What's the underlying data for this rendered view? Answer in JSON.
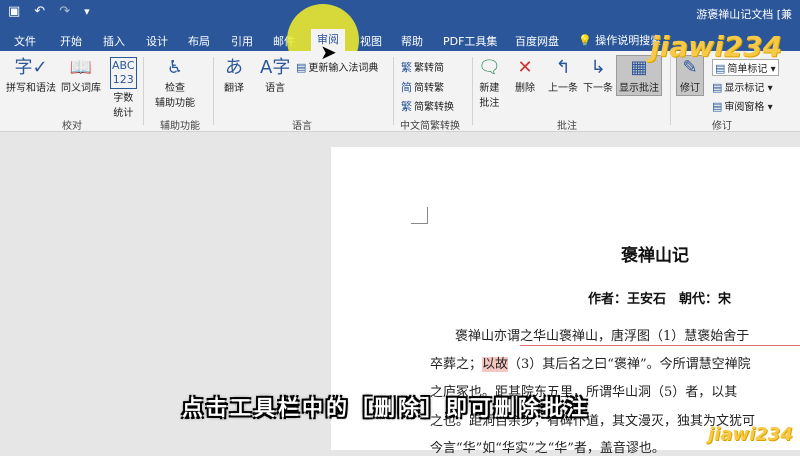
{
  "titlebar": {
    "doc_title": "游褒禅山记文档 [兼",
    "save_icon": "save-icon",
    "undo_icon": "undo-icon",
    "redo_icon": "redo-icon",
    "customize_icon": "customize-icon"
  },
  "tabs": [
    {
      "label": "文件"
    },
    {
      "label": "开始"
    },
    {
      "label": "插入"
    },
    {
      "label": "设计"
    },
    {
      "label": "布局"
    },
    {
      "label": "引用"
    },
    {
      "label": "邮件"
    },
    {
      "label": "审阅"
    },
    {
      "label": "视图"
    },
    {
      "label": "帮助"
    },
    {
      "label": "PDF工具集"
    },
    {
      "label": "百度网盘"
    }
  ],
  "tell_me": "操作说明搜索",
  "ribbon": {
    "proofing": {
      "spelling": "拼写和语法",
      "thesaurus": "同义词库",
      "word_count_1": "字数",
      "word_count_2": "统计",
      "label": "校对"
    },
    "accessibility": {
      "check_1": "检查",
      "check_2": "辅助功能",
      "label": "辅助功能"
    },
    "language": {
      "translate": "翻译",
      "language": "语言",
      "update_ime": "更新输入法词典",
      "label": "语言"
    },
    "chinese": {
      "to_simplified": "繁转简",
      "to_traditional": "简转繁",
      "convert": "简繁转换",
      "label": "中文简繁转换"
    },
    "comments": {
      "new_1": "新建",
      "new_2": "批注",
      "delete": "删除",
      "prev": "上一条",
      "next": "下一条",
      "show": "显示批注",
      "label": "批注"
    },
    "tracking": {
      "track": "修订",
      "simple_markup": "简单标记",
      "show_markup": "显示标记",
      "review_pane": "审阅窗格",
      "label": "修订"
    }
  },
  "document": {
    "title": "褒禅山记",
    "author": "作者：王安石　朝代：宋",
    "line1": "褒禅山亦谓之华山褒禅山，唐浮图（1）慧褒始舍于",
    "line2_a": "卒葬之；",
    "line2_hl": "以故",
    "line2_b": "（3）其后名之曰“褒禅”。今所谓慧空禅院",
    "line3": "之庐冢也。距其院东五里，所谓华山洞（5）者，以其",
    "line4": "之也。距洞百余步，有碑仆道，其文漫灭，独其为文犹可",
    "line5": "今言“华”如“华实”之“华”者，盖音谬也。"
  },
  "subtitle": "点击工具栏中的［删除］即可删除批注",
  "watermark": "jiawi234"
}
